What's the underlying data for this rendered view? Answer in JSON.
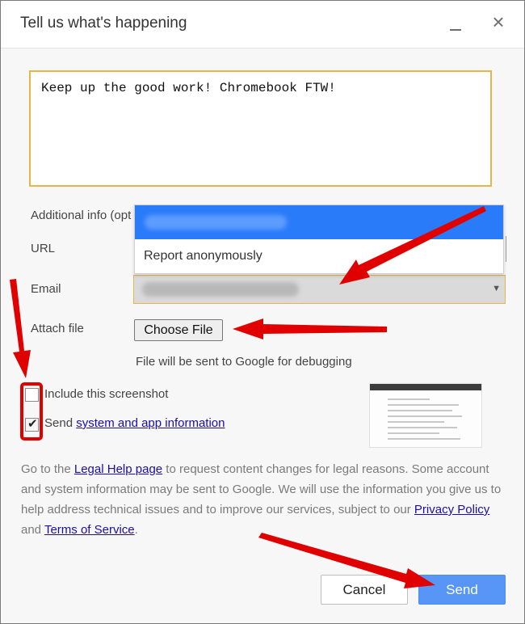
{
  "window": {
    "title": "Tell us what's happening",
    "minimize_icon": "minimize-icon",
    "close_icon": "close-icon"
  },
  "description": {
    "value": "Keep up the good work! Chromebook FTW!"
  },
  "additional_info": {
    "label": "Additional info (opt",
    "url_label": "URL",
    "email_label": "Email",
    "email_dropdown": {
      "options": [
        "Report anonymously"
      ]
    },
    "attach_label": "Attach file",
    "choose_file_label": "Choose File",
    "file_note": "File will be sent to Google for debugging"
  },
  "options": {
    "include_screenshot_label": "Include this screenshot",
    "include_screenshot_checked": false,
    "send_prefix": "Send",
    "send_link": "system and app information",
    "send_checked": true
  },
  "legal": {
    "t1": "Go to the ",
    "link1": "Legal Help page",
    "t2": " to request content changes for legal reasons. Some account and system information may be sent to Google. We will use the information you give us to help address technical issues and to improve our services, subject to our ",
    "link2": "Privacy Policy",
    "t3": " and ",
    "link3": "Terms of Service",
    "t4": "."
  },
  "buttons": {
    "cancel": "Cancel",
    "send": "Send"
  },
  "colors": {
    "annotation_red": "#e00000",
    "accent_blue": "#5796f7",
    "focus_outline": "#e8b54a"
  }
}
